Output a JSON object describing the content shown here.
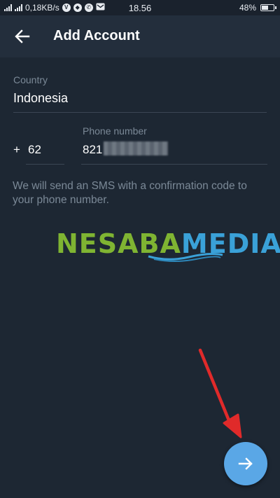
{
  "status_bar": {
    "speed": "0,18KB/s",
    "time": "18.56",
    "battery": "48%",
    "battery_level": 0.48
  },
  "app_bar": {
    "title": "Add Account"
  },
  "form": {
    "country_label": "Country",
    "country_value": "Indonesia",
    "plus_sign": "+",
    "country_code": "62",
    "phone_label": "Phone number",
    "phone_value": "821"
  },
  "info": {
    "text": "We will send an SMS with a confirmation code to your phone number."
  },
  "watermark": {
    "part1": "NESABA",
    "part2": "MEDIA"
  },
  "colors": {
    "background": "#1d2733",
    "app_bar": "#232e3c",
    "fab": "#5aa7e6",
    "annotation": "#e02a2a"
  },
  "icons": {
    "back": "arrow-left-icon",
    "fab": "arrow-right-icon"
  }
}
